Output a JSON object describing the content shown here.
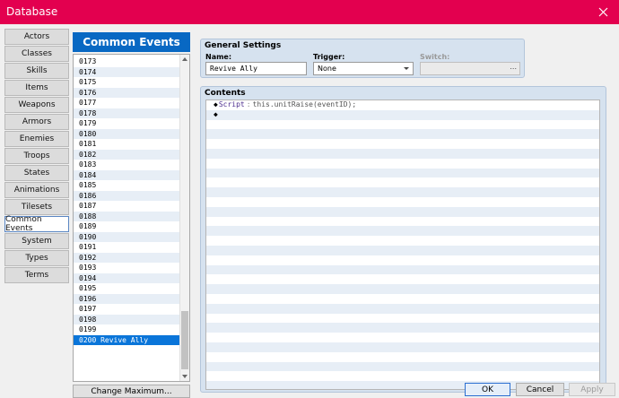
{
  "window": {
    "title": "Database",
    "accent_color": "#e3004f"
  },
  "categories": [
    {
      "label": "Actors"
    },
    {
      "label": "Classes"
    },
    {
      "label": "Skills"
    },
    {
      "label": "Items"
    },
    {
      "label": "Weapons"
    },
    {
      "label": "Armors"
    },
    {
      "label": "Enemies"
    },
    {
      "label": "Troops"
    },
    {
      "label": "States"
    },
    {
      "label": "Animations"
    },
    {
      "label": "Tilesets"
    },
    {
      "label": "Common Events",
      "active": true
    },
    {
      "label": "System"
    },
    {
      "label": "Types"
    },
    {
      "label": "Terms"
    }
  ],
  "event_list": {
    "header": "Common Events",
    "rows": [
      "0173",
      "0174",
      "0175",
      "0176",
      "0177",
      "0178",
      "0179",
      "0180",
      "0181",
      "0182",
      "0183",
      "0184",
      "0185",
      "0186",
      "0187",
      "0188",
      "0189",
      "0190",
      "0191",
      "0192",
      "0193",
      "0194",
      "0195",
      "0196",
      "0197",
      "0198",
      "0199",
      "0200 Revive Ally"
    ],
    "selected_index": 27,
    "change_max_label": "Change Maximum..."
  },
  "general": {
    "title": "General Settings",
    "name_label": "Name:",
    "name_value": "Revive Ally",
    "trigger_label": "Trigger:",
    "trigger_value": "None",
    "switch_label": "Switch:",
    "switch_button": "..."
  },
  "contents": {
    "title": "Contents",
    "commands": [
      {
        "name": "Script",
        "colon": ":",
        "code": "this.unitRaise(eventID);"
      },
      {
        "name": "",
        "colon": "",
        "code": ""
      }
    ]
  },
  "footer": {
    "ok": "OK",
    "cancel": "Cancel",
    "apply": "Apply"
  }
}
